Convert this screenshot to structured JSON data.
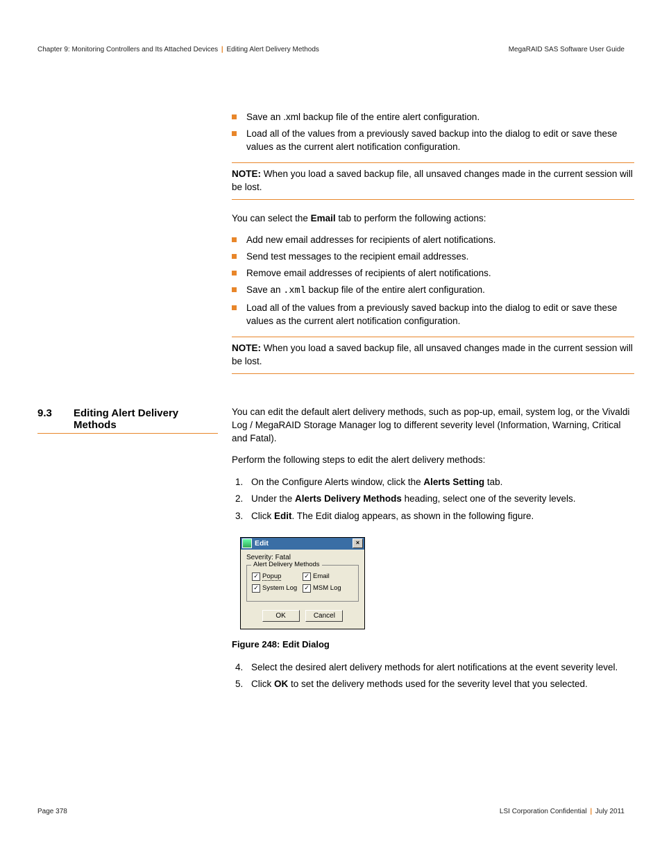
{
  "header": {
    "chapter": "Chapter 9: Monitoring Controllers and Its Attached Devices",
    "section": "Editing Alert Delivery Methods",
    "guide": "MegaRAID SAS Software User Guide"
  },
  "footer": {
    "page": "Page 378",
    "conf": "LSI Corporation Confidential",
    "date": "July 2011"
  },
  "bullets1": {
    "b1": "Save an .xml backup file of the entire alert configuration.",
    "b2": "Load all of the values from a previously saved backup into the dialog to edit or save these values as the current alert notification configuration."
  },
  "note1": {
    "label": "NOTE:",
    "text": "When you load a saved backup file, all unsaved changes made in the current session will be lost."
  },
  "email_intro_pre": "You can select the ",
  "email_intro_bold": "Email",
  "email_intro_post": " tab to perform the following actions:",
  "bullets2": {
    "b1": "Add new email addresses for recipients of alert notifications.",
    "b2": "Send test messages to the recipient email addresses.",
    "b3": "Remove email addresses of recipients of alert notifications.",
    "b4_pre": "Save an ",
    "b4_code": ".xml",
    "b4_post": " backup file of the entire alert configuration.",
    "b5": "Load all of the values from a previously saved backup into the dialog to edit or save these values as the current alert notification configuration."
  },
  "note2": {
    "label": "NOTE:",
    "text": "When you load a saved backup file, all unsaved changes made in the current session will be lost."
  },
  "section": {
    "num": "9.3",
    "title": "Editing Alert Delivery Methods"
  },
  "sec_intro": "You can edit the default alert delivery methods, such as pop-up, email, system log, or the Vivaldi Log / MegaRAID Storage Manager log to different severity level (Information, Warning, Critical and Fatal).",
  "sec_perform": "Perform the following steps to edit the alert delivery methods:",
  "steps": {
    "s1_pre": "On the Configure Alerts window, click the ",
    "s1_b": "Alerts Setting",
    "s1_post": " tab.",
    "s2_pre": "Under the ",
    "s2_b": "Alerts Delivery Methods",
    "s2_post": " heading, select one of the severity levels.",
    "s3_pre": "Click ",
    "s3_b": "Edit",
    "s3_post": ". The Edit dialog appears, as shown in the following figure."
  },
  "dialog": {
    "title": "Edit",
    "severity": "Severity: Fatal",
    "group": "Alert Delivery Methods",
    "cb_popup": "Popup",
    "cb_email": "Email",
    "cb_syslog": "System Log",
    "cb_msm": "MSM Log",
    "ok": "OK",
    "cancel": "Cancel"
  },
  "figure": "Figure 248:    Edit Dialog",
  "steps2": {
    "s4": "Select the desired alert delivery methods for alert notifications at the event severity level.",
    "s5_pre": "Click ",
    "s5_b": "OK",
    "s5_post": " to set the delivery methods used for the severity level that you selected."
  }
}
